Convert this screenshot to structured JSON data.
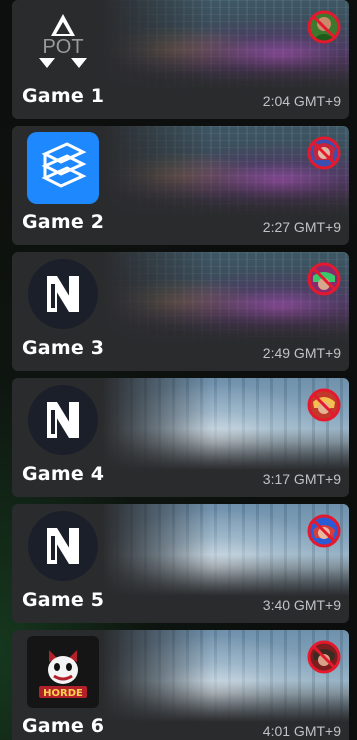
{
  "colors": {
    "card_bg": "#2a2b2d",
    "title": "#ffffff",
    "time": "#bfc2c6",
    "ban_red": "#e5192d",
    "blue_logo": "#1e88ff"
  },
  "games": [
    {
      "title": "Game 1",
      "time": "2:04 GMT+9",
      "logo": "pot-logo-icon",
      "logo_text": "POT",
      "banner": "city",
      "avatar": "hero-avatar-green-icon"
    },
    {
      "title": "Game 2",
      "time": "2:27 GMT+9",
      "logo": "blue-stack-logo-icon",
      "banner": "city",
      "avatar": "hero-avatar-redhair-icon"
    },
    {
      "title": "Game 3",
      "time": "2:49 GMT+9",
      "logo": "n-circle-logo-icon",
      "banner": "city",
      "avatar": "hero-avatar-green-mask-icon"
    },
    {
      "title": "Game 4",
      "time": "3:17 GMT+9",
      "logo": "n-circle-logo-icon",
      "banner": "sky",
      "avatar": "hero-avatar-blonde-icon"
    },
    {
      "title": "Game 5",
      "time": "3:40 GMT+9",
      "logo": "n-circle-logo-icon",
      "banner": "sky",
      "avatar": "hero-avatar-blue-icon"
    },
    {
      "title": "Game 6",
      "time": "4:01 GMT+9",
      "logo": "horde-logo-icon",
      "logo_text": "HORDE",
      "banner": "sky",
      "avatar": "hero-avatar-dark-icon"
    }
  ]
}
